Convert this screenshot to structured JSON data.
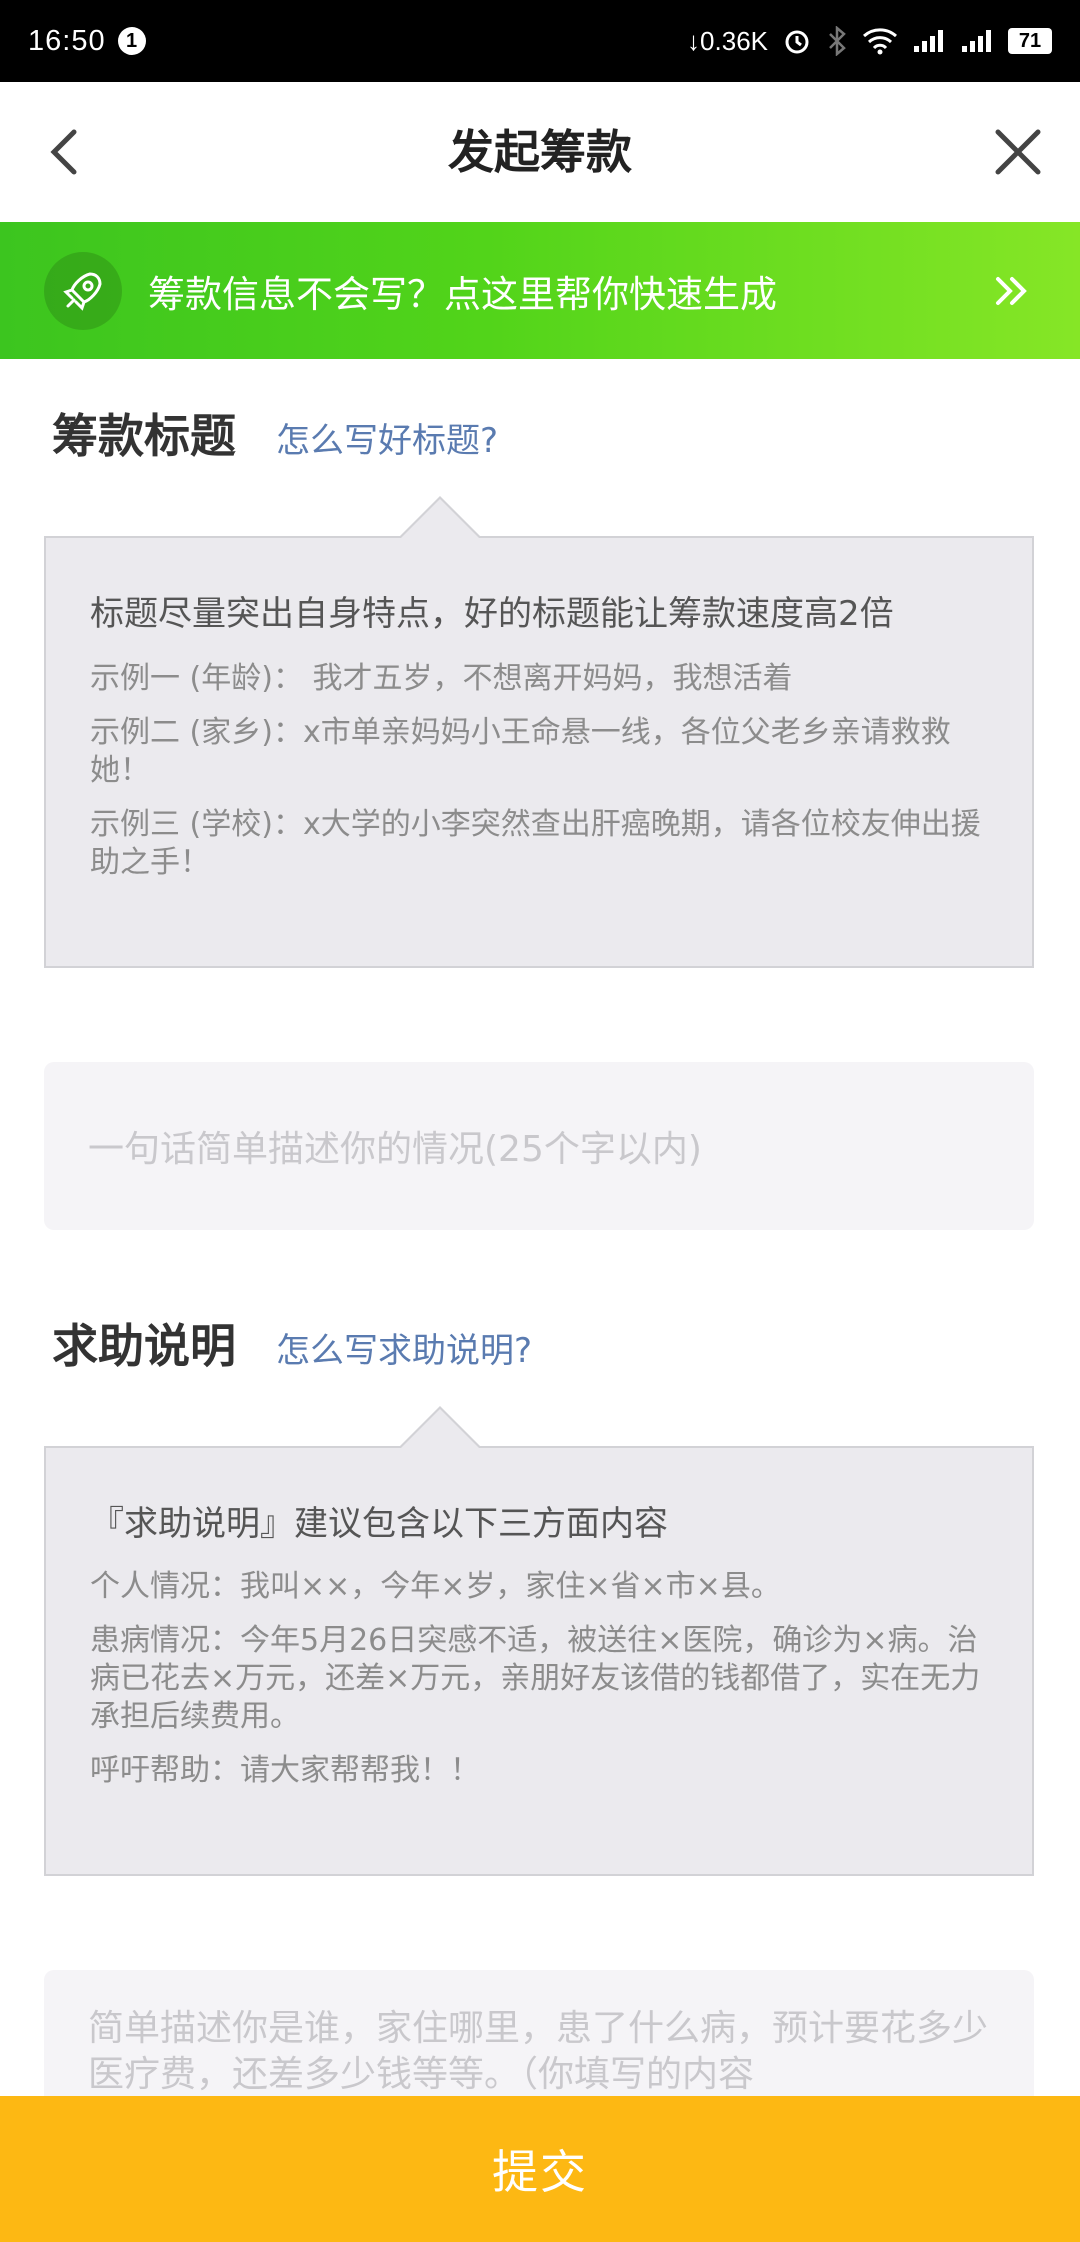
{
  "status_bar": {
    "time": "16:50",
    "notification_count": "1",
    "network_speed": "↓0.36K",
    "battery_level": "71"
  },
  "header": {
    "title": "发起筹款"
  },
  "banner": {
    "text": "筹款信息不会写？点这里帮你快速生成"
  },
  "title_section": {
    "heading": "筹款标题",
    "help_link": "怎么写好标题?",
    "tip_heading": "标题尽量突出自身特点，好的标题能让筹款速度高2倍",
    "examples": [
      "示例一 (年龄)：  我才五岁，不想离开妈妈，我想活着",
      "示例二 (家乡)：x市单亲妈妈小王命悬一线，各位父老乡亲请救救她！",
      "示例三 (学校)：x大学的小李突然查出肝癌晚期，请各位校友伸出援助之手！"
    ],
    "input_placeholder": "一句话简单描述你的情况(25个字以内)"
  },
  "description_section": {
    "heading": "求助说明",
    "help_link": "怎么写求助说明?",
    "tip_heading": "『求助说明』建议包含以下三方面内容",
    "items": [
      "个人情况：我叫××，今年×岁，家住×省×市×县。",
      "患病情况：今年5月26日突感不适，被送往×医院，确诊为×病。治病已花去×万元，还差×万元，亲朋好友该借的钱都借了，实在无力承担后续费用。",
      "呼吁帮助：请大家帮帮我！！"
    ],
    "input_placeholder": "简单描述你是谁，家住哪里，患了什么病，预计要花多少医疗费，还差多少钱等等。（你填写的内容"
  },
  "submit": {
    "label": "提交"
  },
  "colors": {
    "banner_start": "#3cc51f",
    "banner_end": "#86e626",
    "submit": "#fdb813",
    "link": "#5a7bb0"
  }
}
